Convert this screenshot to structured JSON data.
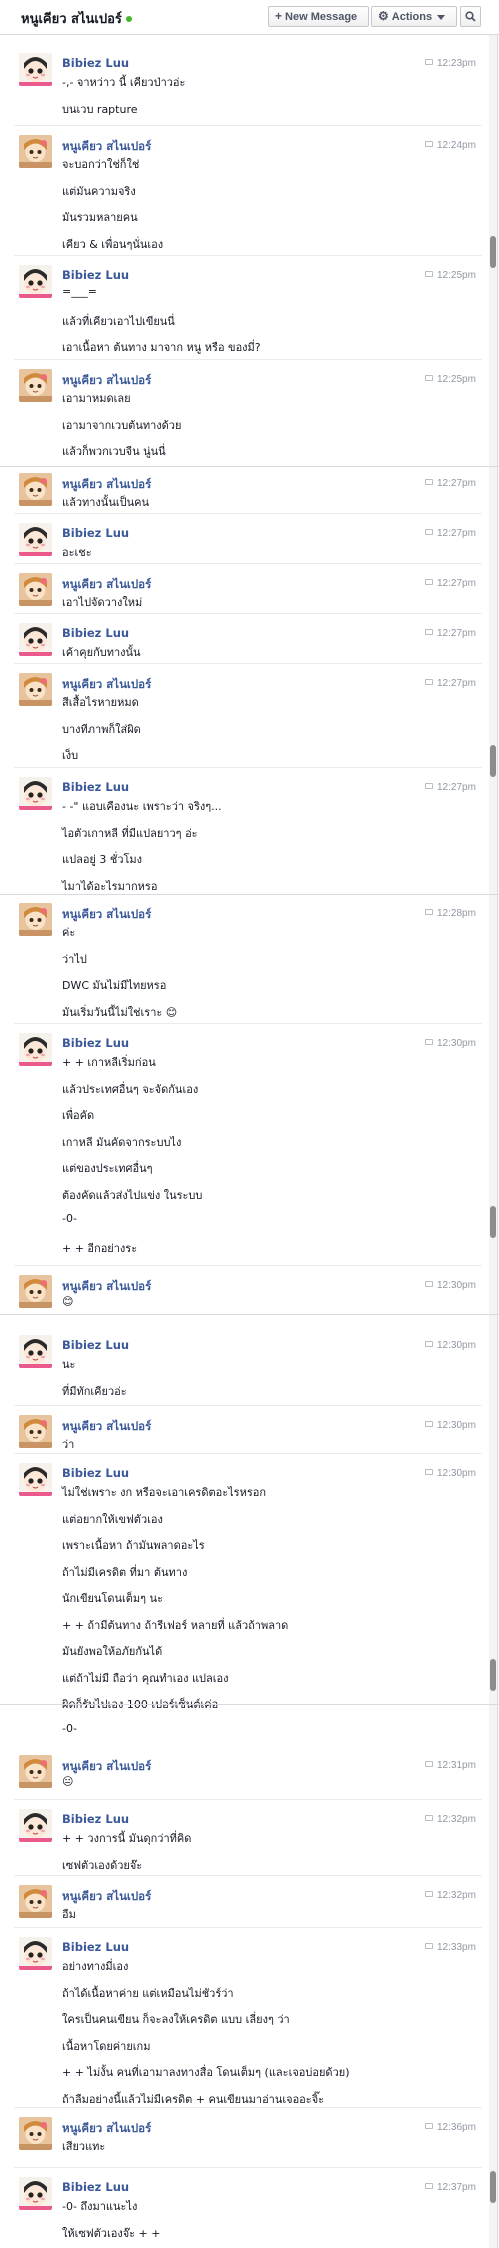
{
  "header": {
    "title": "หนูเคียว สไนเปอร์",
    "new_message": "New Message",
    "actions": "Actions"
  },
  "messages": [
    {
      "sender": "Bibiez Luu",
      "who": "b",
      "time": "12:23pm",
      "lines": [
        "-,- จาหว่าว นี้ เคียวป่าวอ่ะ",
        "บนเวบ rapture"
      ]
    },
    {
      "sender": "หนูเคียว สไนเปอร์",
      "who": "n",
      "time": "12:24pm",
      "lines": [
        "จะบอกว่าใช่ก็ใช่",
        "แต่มันความจริง",
        "มันรวมหลายคน",
        "เคียว & เพื่อนๆนั่นเอง"
      ]
    },
    {
      "sender": "Bibiez Luu",
      "who": "b",
      "time": "12:25pm",
      "lines": [
        "=___=",
        "แล้วที่เคียวเอาไปเขียนนี่",
        "เอาเนื้อหา ต้นทาง มาจาก หนู หรือ ของมี่?"
      ]
    },
    {
      "sender": "หนูเคียว สไนเปอร์",
      "who": "n",
      "time": "12:25pm",
      "lines": [
        "เอามาหมดเลย",
        "เอามาจากเวบต้นทางด้วย",
        "แล้วก็พวกเวบจีน นู่นนี่"
      ]
    },
    {
      "sender": "หนูเคียว สไนเปอร์",
      "who": "n",
      "time": "12:27pm",
      "lines": [
        "แล้วทางนั้นเป็นคน"
      ]
    },
    {
      "sender": "Bibiez Luu",
      "who": "b",
      "time": "12:27pm",
      "lines": [
        "อะเชะ"
      ]
    },
    {
      "sender": "หนูเคียว สไนเปอร์",
      "who": "n",
      "time": "12:27pm",
      "lines": [
        "เอาไปจัดวางใหม่"
      ]
    },
    {
      "sender": "Bibiez Luu",
      "who": "b",
      "time": "12:27pm",
      "lines": [
        "เค้าคุยกับทางนั้น"
      ]
    },
    {
      "sender": "หนูเคียว สไนเปอร์",
      "who": "n",
      "time": "12:27pm",
      "lines": [
        "สีเสื้อไรหายหมด",
        "บางทีภาพก็ใส่ผิด",
        "เง็บ"
      ]
    },
    {
      "sender": "Bibiez Luu",
      "who": "b",
      "time": "12:27pm",
      "lines": [
        "- -\" แอบเคืองนะ เพราะว่า จริงๆ...",
        "ไอตัวเกาหลี ที่มีแปลยาวๆ อ่ะ",
        "แปลอยู่ 3 ชั่วโมง",
        "ไมาได้อะไรมากหรอ"
      ]
    },
    {
      "sender": "หนูเคียว สไนเปอร์",
      "who": "n",
      "time": "12:28pm",
      "lines": [
        "ค่ะ",
        "ว่าไป",
        "DWC มันไม่มีไทยหรอ",
        "มันเริ่มวันนี้ไม่ใช่เราะ 😊"
      ]
    },
    {
      "sender": "Bibiez Luu",
      "who": "b",
      "time": "12:30pm",
      "lines": [
        "+ + เกาหลีเริ่มก่อน",
        "แล้วประเทศอื่นๆ จะจัดกันเอง",
        "เพื่อคัด",
        "เกาหลี มันคัดจากระบบไง",
        "แต่ของประเทศอื่นๆ",
        "ต้องคัดแล้วส่งไปแข่ง ในระบบ",
        "-0-",
        "+ + อีกอย่างระ"
      ]
    },
    {
      "sender": "หนูเคียว สไนเปอร์",
      "who": "n",
      "time": "12:30pm",
      "lines": [
        "😊"
      ]
    },
    {
      "sender": "Bibiez Luu",
      "who": "b",
      "time": "12:30pm",
      "lines": [
        "นะ",
        "ที่มีทักเคียวอ่ะ"
      ]
    },
    {
      "sender": "หนูเคียว สไนเปอร์",
      "who": "n",
      "time": "12:30pm",
      "lines": [
        "ว่า"
      ]
    },
    {
      "sender": "Bibiez Luu",
      "who": "b",
      "time": "12:30pm",
      "lines": [
        "ไม่ใช่เพราะ งก หรือจะเอาเครดิตอะไรหรอก",
        "แต่อยากให้เขฟตัวเอง",
        "เพราะเนื้อหา ถ้ามันพลาดอะไร",
        "ถ้าไม่มีเครดิต ที่มา ต้นทาง",
        "นักเขียนโดนเต็มๆ นะ",
        "+ + ถ้ามีต้นทาง ถ้ารีเฟอร์ หลายที่ แล้วถ้าพลาด",
        "มันยังพอให้อภัยกันได้",
        "แต่ถ้าไม่มี ถือว่า คุณทำเอง แปลเอง",
        "ผิดก็รับไปเอง 100 เปอร์เซ็นต์เค่อ",
        "-0-"
      ]
    },
    {
      "sender": "หนูเคียว สไนเปอร์",
      "who": "n",
      "time": "12:31pm",
      "lines": [
        "😐"
      ]
    },
    {
      "sender": "Bibiez Luu",
      "who": "b",
      "time": "12:32pm",
      "lines": [
        "+ + วงการนี้ มันดุกว่าที่คิด",
        "เซฟตัวเองด้วยจ๊ะ"
      ]
    },
    {
      "sender": "หนูเคียว สไนเปอร์",
      "who": "n",
      "time": "12:32pm",
      "lines": [
        "อืม"
      ]
    },
    {
      "sender": "Bibiez Luu",
      "who": "b",
      "time": "12:33pm",
      "lines": [
        "อย่างทางมี่เอง",
        "ถ้าได้เนื้อหาค่าย แต่เหมือนไม่ชัวร์ว่า",
        "ใครเป็นคนเขียน ก็จะลงให้เครดิต แบบ เลี่ยงๆ ว่า",
        "เนื้อหาโดยค่ายเกม",
        "+ + ไม่งั้น คนที่เอามาลงทางสื่อ โดนเต็มๆ (และเจอบ่อยด้วย)",
        "ถ้าลืมอย่างนี้แล้วไม่มีเครดิต + คนเขียนมาอ่านเจออะจิ๊ะ"
      ]
    },
    {
      "sender": "หนูเคียว สไนเปอร์",
      "who": "n",
      "time": "12:36pm",
      "lines": [
        "เสียวแทะ"
      ]
    },
    {
      "sender": "Bibiez Luu",
      "who": "b",
      "time": "12:37pm",
      "lines": [
        "-0- ถึงมาแนะไง",
        "ให้เซฟตัวเองจ๊ะ + +"
      ]
    }
  ]
}
